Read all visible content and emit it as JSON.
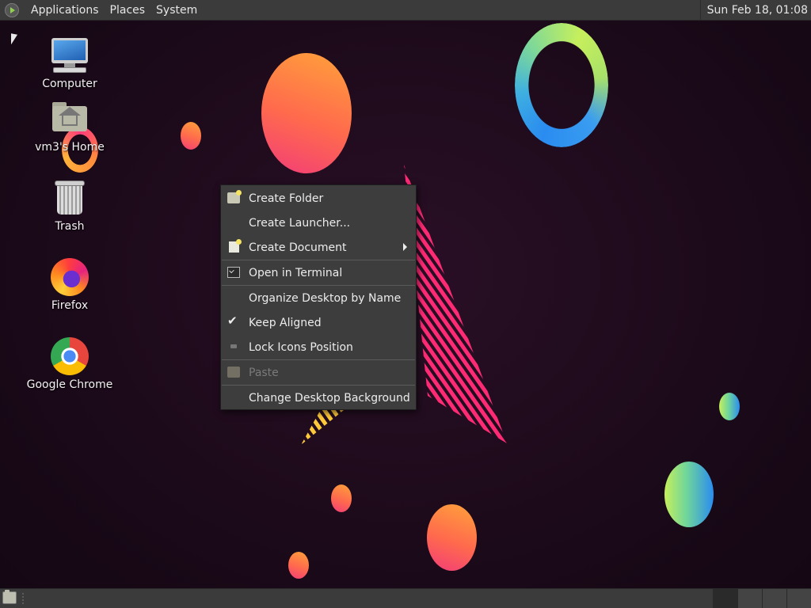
{
  "top_panel": {
    "menus": [
      "Applications",
      "Places",
      "System"
    ],
    "clock": "Sun Feb 18, 01:08"
  },
  "desktop": {
    "icons": [
      {
        "label": "Computer",
        "icon": "computer-icon"
      },
      {
        "label": "vm3's Home",
        "icon": "home-folder-icon"
      },
      {
        "label": "Trash",
        "icon": "trash-icon"
      },
      {
        "label": "Firefox",
        "icon": "firefox-icon"
      },
      {
        "label": "Google Chrome",
        "icon": "chrome-icon"
      }
    ]
  },
  "context_menu": {
    "items": [
      {
        "label": "Create Folder",
        "icon": "folder-new-icon"
      },
      {
        "label": "Create Launcher...",
        "icon": ""
      },
      {
        "label": "Create Document",
        "icon": "document-new-icon",
        "submenu": true
      },
      {
        "label": "Open in Terminal",
        "icon": "terminal-icon"
      },
      {
        "label": "Organize Desktop by Name",
        "icon": ""
      },
      {
        "label": "Keep Aligned",
        "icon": "check-icon",
        "checked": true
      },
      {
        "label": "Lock Icons Position",
        "icon": "lock-icon"
      },
      {
        "label": "Paste",
        "icon": "paste-icon",
        "disabled": true
      },
      {
        "label": "Change Desktop Background",
        "icon": ""
      }
    ]
  },
  "colors": {
    "panel": "#3b3b3b",
    "menu_bg": "#3d3d3d",
    "wallpaper": "#1c0a1a"
  }
}
